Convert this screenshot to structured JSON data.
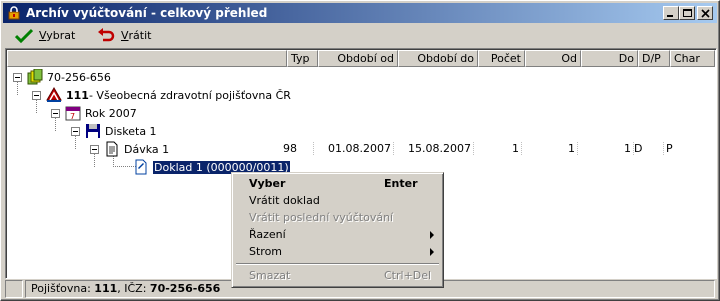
{
  "window": {
    "title": "Archív vyúčtování - celkový přehled"
  },
  "toolbar": {
    "select_label": "Vybrat",
    "select_key": "V",
    "return_label_key": "V",
    "return_label_rest": "rátit"
  },
  "columns": {
    "type": "Typ",
    "period_from": "Období od",
    "period_to": "Období do",
    "count": "Počet",
    "from": "Od",
    "to": "Do",
    "dp": "D/P",
    "char": "Char"
  },
  "tree": {
    "root": "70-256-656",
    "insurer_code": "111",
    "insurer_name": " - Všeobecná zdravotní pojišťovna ČR",
    "year": "Rok 2007",
    "disk": "Disketa 1",
    "batch": "Dávka 1",
    "document": "Doklad 1 (000000/0011)"
  },
  "batch_row": {
    "type": "98",
    "period_from": "01.08.2007",
    "period_to": "15.08.2007",
    "count": "1",
    "from": "1",
    "to": "1",
    "dp": "D",
    "char": "P"
  },
  "context_menu": {
    "select": "Vyber",
    "select_shortcut": "Enter",
    "return_doc": "Vrátit doklad",
    "return_last": "Vrátit poslední vyúčtování",
    "sorting": "Řazení",
    "tree": "Strom",
    "delete": "Smazat",
    "delete_shortcut": "Ctrl+Del"
  },
  "status": {
    "prefix": "Pojišťovna: ",
    "code": "111",
    "mid": ", IČZ: ",
    "icz": "70-256-656"
  },
  "colors": {
    "title_start": "#0a246a",
    "title_end": "#a6caf0",
    "selection": "#0a246a"
  }
}
